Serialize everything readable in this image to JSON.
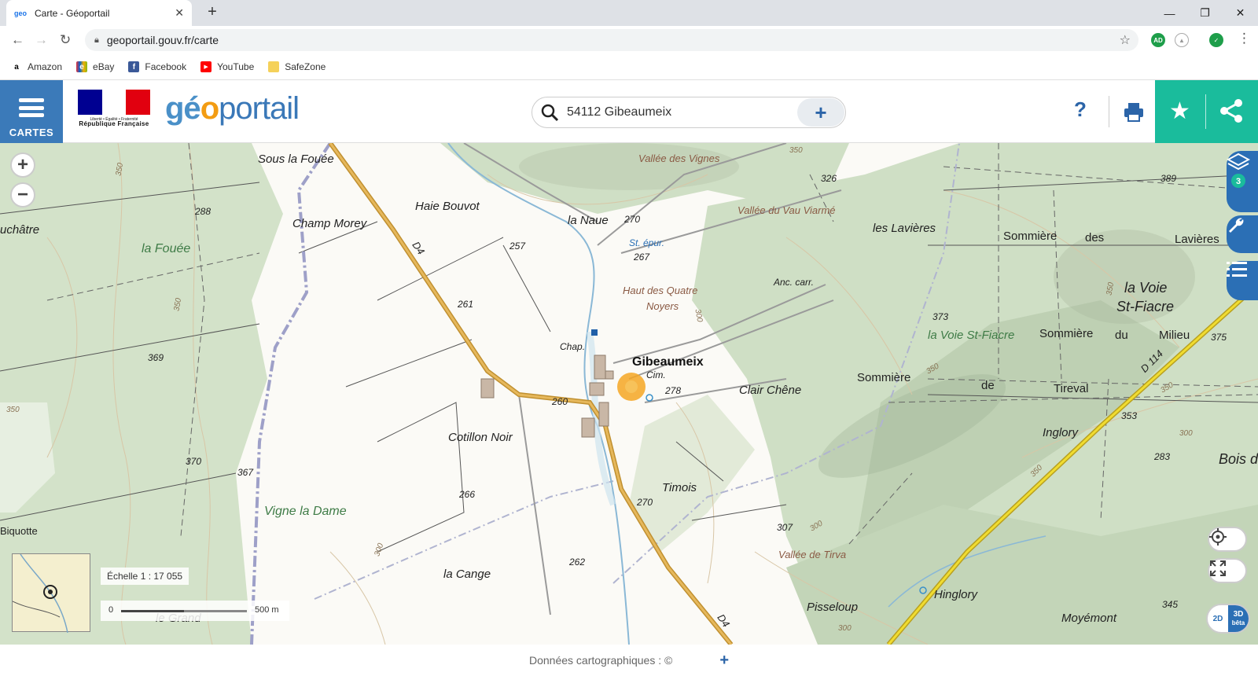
{
  "browser": {
    "tab_title": "Carte - Géoportail",
    "tab_favicon": "geo",
    "url": "geoportail.gouv.fr/carte",
    "bookmarks": [
      {
        "label": "Amazon",
        "icon": "a",
        "color": "#000000"
      },
      {
        "label": "eBay",
        "icon": "e",
        "color": "#333333"
      },
      {
        "label": "Facebook",
        "icon": "f",
        "color": "#3b5998"
      },
      {
        "label": "YouTube",
        "icon": "▶",
        "color": "#ff0000"
      },
      {
        "label": "SafeZone",
        "icon": "",
        "color": "#f5d15a"
      }
    ],
    "extensions": [
      {
        "label": "AD",
        "color": "#1e9e4a"
      },
      {
        "label": "",
        "color": "#9e9e9e"
      },
      {
        "label": "",
        "color": "#1e9e4a"
      }
    ]
  },
  "header": {
    "menu_label": "CARTES",
    "rf_motto": "Liberté • Égalité • Fraternité",
    "rf_name": "République Française",
    "logo": {
      "part1": "gé",
      "part2": "o",
      "part3": "portail"
    },
    "search_value": "54112 Gibeaumeix",
    "help_label": "?"
  },
  "map": {
    "village": "Gibeaumeix",
    "labels": {
      "sous_la_fouee": "Sous la Fouée",
      "haie_bouvot": "Haie Bouvot",
      "champ_morey": "Champ Morey",
      "la_fouee": "la Fouée",
      "uchatre": "uchâtre",
      "la_naue": "la Naue",
      "st_epur": "St. épur.",
      "vallee_vignes": "Vallée des Vignes",
      "vallee_vau": "Vallée du Vau Viarmé",
      "les_lavieres": "les Lavières",
      "sommiere1": "Sommière",
      "des": "des",
      "lavieres2": "Lavières",
      "haut_quatre": "Haut des Quatre",
      "noyers": "Noyers",
      "anc_carr": "Anc. carr.",
      "la_voie": "la Voie",
      "st_fiacre": "St-Fiacre",
      "la_voie_st_fiacre": "la Voie St-Fiacre",
      "sommiere2": "Sommière",
      "du": "du",
      "milieu": "Milieu",
      "chap": "Chap.",
      "cim": "Cim.",
      "clair_chene": "Clair Chêne",
      "sommiere3": "Sommière",
      "de": "de",
      "tireval": "Tireval",
      "cotillon_noir": "Cotillon Noir",
      "inglory": "Inglory",
      "bois": "Bois d",
      "timois": "Timois",
      "vigne_dame": "Vigne la Dame",
      "biquotte": "Biquotte",
      "la_cange": "la Cange",
      "vallee_tirva": "Vallée de Tirva",
      "hinglory": "Hinglory",
      "pisseloup": "Pisseloup",
      "moyemont": "Moyémont",
      "le_grand": "le Grand",
      "d4a": "D4",
      "d4b": "D4",
      "d114": "D 114"
    },
    "altitudes": [
      "288",
      "257",
      "270",
      "326",
      "389",
      "267",
      "261",
      "369",
      "373",
      "375",
      "278",
      "260",
      "353",
      "370",
      "367",
      "266",
      "270",
      "307",
      "283",
      "262",
      "345"
    ],
    "contours": [
      "350",
      "350",
      "350",
      "350",
      "350",
      "300",
      "350",
      "350",
      "300",
      "300",
      "350",
      "300",
      "300"
    ],
    "layers_count": "3",
    "scale_label": "Échelle 1 : 17 055",
    "scale_start": "0",
    "scale_end": "500 m",
    "view_2d": "2D",
    "view_3d": "3D",
    "view_3d_sub": "bêta"
  },
  "footer": {
    "credit": "Données cartographiques : ©",
    "plus": "+"
  },
  "colors": {
    "brand_blue": "#3b7ab9",
    "teal": "#1abc9c",
    "road_orange": "#d8a84a",
    "road_yellow": "#e8d22a",
    "forest": "#c9dcc0"
  }
}
